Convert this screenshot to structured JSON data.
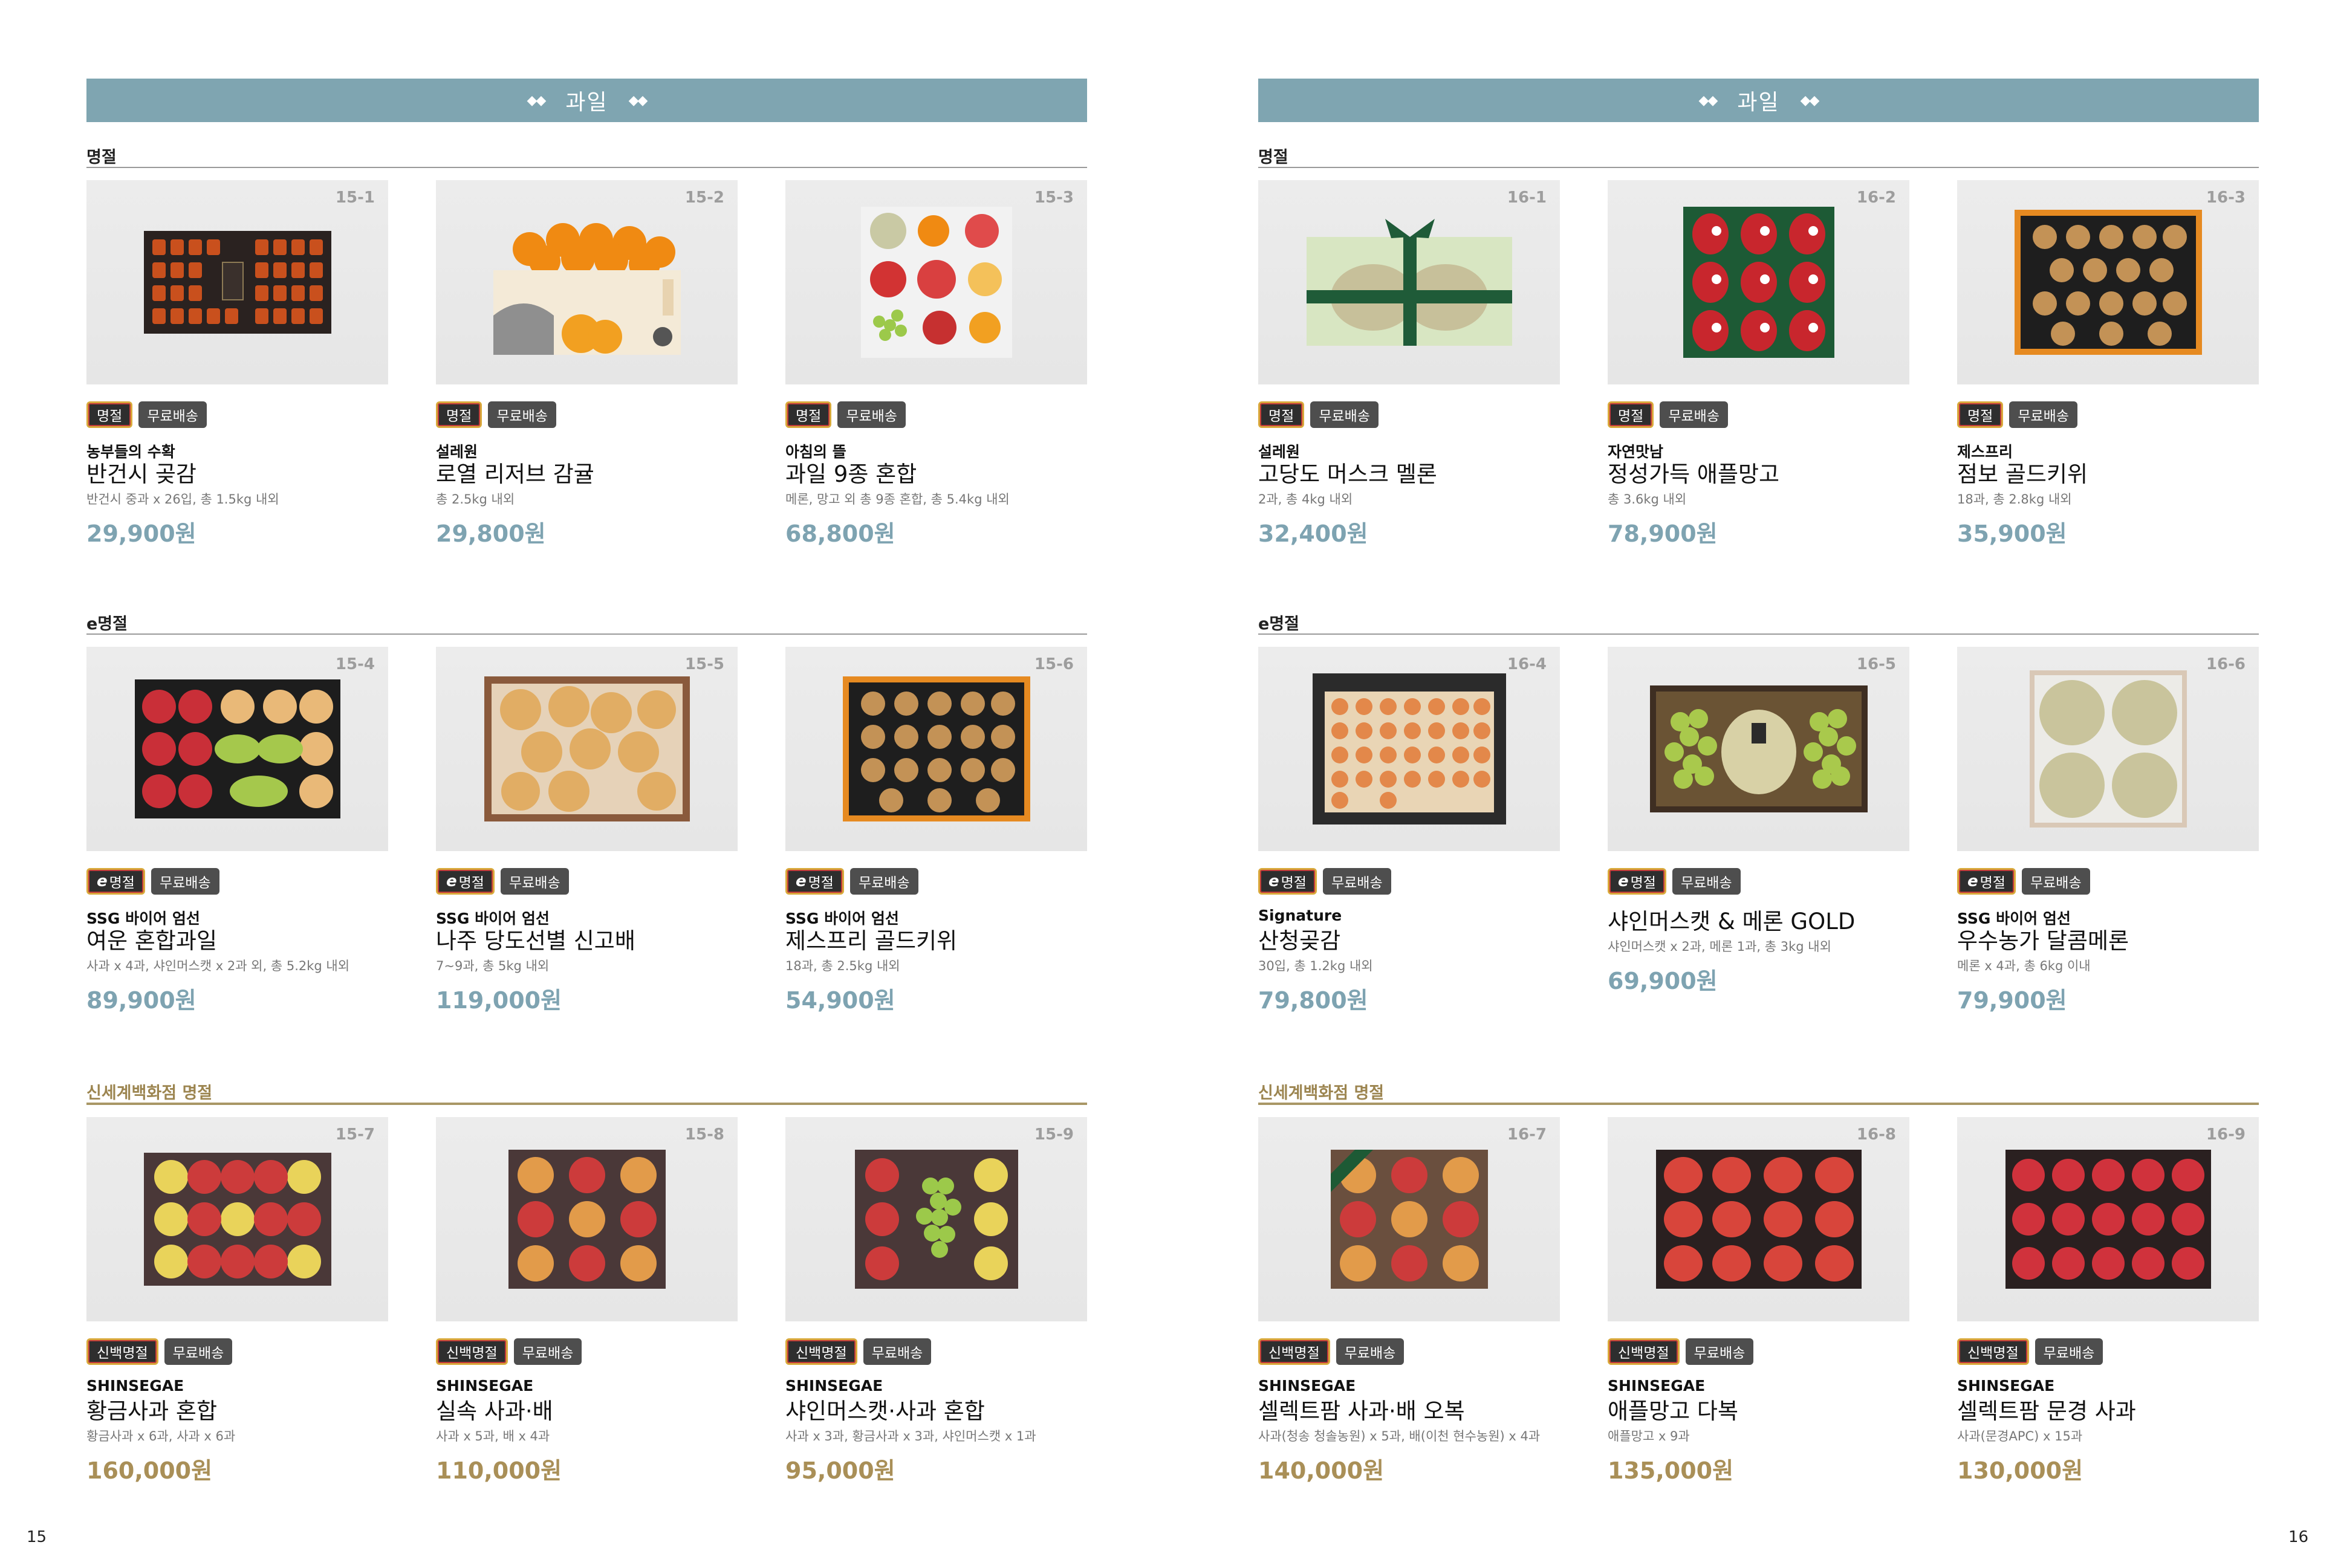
{
  "pages": [
    {
      "number": "15",
      "banner": "과일",
      "sections": [
        {
          "title": "명절",
          "products": [
            {
              "code": "15-1",
              "badge": "명절",
              "shipping": "무료배송",
              "brand": "농부들의 수확",
              "name": "반건시 곶감",
              "desc": "반건시 중과 x 26입, 총 1.5kg 내외",
              "price": "29,900원"
            },
            {
              "code": "15-2",
              "badge": "명절",
              "shipping": "무료배송",
              "brand": "설레원",
              "name": "로열 리저브 감귤",
              "desc": "총 2.5kg 내외",
              "price": "29,800원"
            },
            {
              "code": "15-3",
              "badge": "명절",
              "shipping": "무료배송",
              "brand": "아침의 뜰",
              "name": "과일 9종 혼합",
              "desc": "메론, 망고 외 총 9종 혼합, 총 5.4kg 내외",
              "price": "68,800원"
            }
          ]
        },
        {
          "title": "e명절",
          "products": [
            {
              "code": "15-4",
              "badge_e": "e",
              "badge": "명절",
              "shipping": "무료배송",
              "brand": "SSG 바이어 엄선",
              "name": "여운 혼합과일",
              "desc": "사과 x 4과, 샤인머스캣 x 2과 외, 총 5.2kg 내외",
              "price": "89,900원"
            },
            {
              "code": "15-5",
              "badge_e": "e",
              "badge": "명절",
              "shipping": "무료배송",
              "brand": "SSG 바이어 엄선",
              "name": "나주 당도선별 신고배",
              "desc": "7~9과, 총 5kg 내외",
              "price": "119,000원"
            },
            {
              "code": "15-6",
              "badge_e": "e",
              "badge": "명절",
              "shipping": "무료배송",
              "brand": "SSG 바이어 엄선",
              "name": "제스프리 골드키위",
              "desc": "18과,  총 2.5kg 내외",
              "price": "54,900원"
            }
          ]
        },
        {
          "title": "신세계백화점 명절",
          "products": [
            {
              "code": "15-7",
              "badge": "신백명절",
              "shipping": "무료배송",
              "brand": "SHINSEGAE",
              "name": "황금사과 혼합",
              "desc": "황금사과 x 6과, 사과 x 6과",
              "price": "160,000원"
            },
            {
              "code": "15-8",
              "badge": "신백명절",
              "shipping": "무료배송",
              "brand": "SHINSEGAE",
              "name": "실속 사과·배",
              "desc": "사과 x 5과, 배 x 4과",
              "price": "110,000원"
            },
            {
              "code": "15-9",
              "badge": "신백명절",
              "shipping": "무료배송",
              "brand": "SHINSEGAE",
              "name": "샤인머스캣·사과 혼합",
              "desc": "사과 x 3과, 황금사과 x 3과, 샤인머스캣 x 1과",
              "price": "95,000원"
            }
          ]
        }
      ]
    },
    {
      "number": "16",
      "banner": "과일",
      "sections": [
        {
          "title": "명절",
          "products": [
            {
              "code": "16-1",
              "badge": "명절",
              "shipping": "무료배송",
              "brand": "설레원",
              "name": "고당도 머스크 멜론",
              "desc": "2과, 총 4kg 내외",
              "price": "32,400원"
            },
            {
              "code": "16-2",
              "badge": "명절",
              "shipping": "무료배송",
              "brand": "자연맛남",
              "name": "정성가득 애플망고",
              "desc": "총 3.6kg 내외",
              "price": "78,900원"
            },
            {
              "code": "16-3",
              "badge": "명절",
              "shipping": "무료배송",
              "brand": "제스프리",
              "name": "점보 골드키위",
              "desc": "18과,  총 2.8kg 내외",
              "price": "35,900원"
            }
          ]
        },
        {
          "title": "e명절",
          "products": [
            {
              "code": "16-4",
              "badge_e": "e",
              "badge": "명절",
              "shipping": "무료배송",
              "brand": "Signature",
              "name": "산청곶감",
              "desc": "30입, 총 1.2kg 내외",
              "price": "79,800원"
            },
            {
              "code": "16-5",
              "badge_e": "e",
              "badge": "명절",
              "shipping": "무료배송",
              "brand": "",
              "name": "샤인머스캣 & 메론 GOLD",
              "desc": "샤인머스캣 x 2과, 메론 1과, 총 3kg 내외",
              "price": "69,900원"
            },
            {
              "code": "16-6",
              "badge_e": "e",
              "badge": "명절",
              "shipping": "무료배송",
              "brand": "SSG 바이어 엄선",
              "name": "우수농가 달콤메론",
              "desc": "메론 x 4과, 총 6kg 이내",
              "price": "79,900원"
            }
          ]
        },
        {
          "title": "신세계백화점 명절",
          "products": [
            {
              "code": "16-7",
              "badge": "신백명절",
              "shipping": "무료배송",
              "brand": "SHINSEGAE",
              "name": "셀렉트팜 사과·배 오복",
              "desc": "사과(청송 청솔농원) x 5과, 배(이천 현수농원) x 4과",
              "price": "140,000원"
            },
            {
              "code": "16-8",
              "badge": "신백명절",
              "shipping": "무료배송",
              "brand": "SHINSEGAE",
              "name": "애플망고 다복",
              "desc": "애플망고 x 9과",
              "price": "135,000원"
            },
            {
              "code": "16-9",
              "badge": "신백명절",
              "shipping": "무료배송",
              "brand": "SHINSEGAE",
              "name": "셀렉트팜 문경 사과",
              "desc": "사과(문경APC) x 15과",
              "price": "130,000원"
            }
          ]
        }
      ]
    }
  ]
}
